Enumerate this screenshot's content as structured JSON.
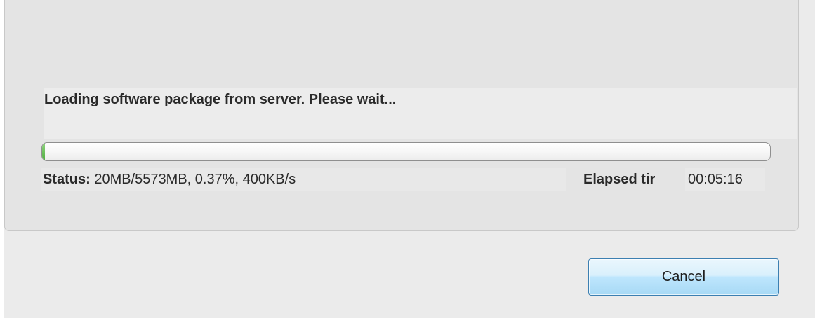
{
  "message": "Loading software package from server. Please wait...",
  "progress": {
    "fraction": 0.0037
  },
  "status": {
    "label": "Status:",
    "value": "20MB/5573MB, 0.37%, 400KB/s"
  },
  "elapsed": {
    "label": "Elapsed tir",
    "value": "00:05:16"
  },
  "buttons": {
    "cancel_label": "Cancel"
  },
  "colors": {
    "button_border": "#3c7fb1",
    "progress_fill": "#4fae3f"
  }
}
